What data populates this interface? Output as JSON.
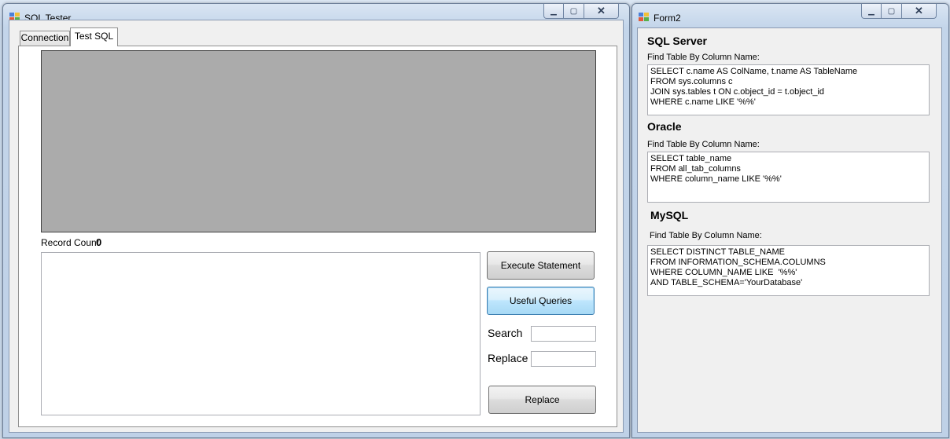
{
  "windows": {
    "sql_tester": {
      "title": "SQL Tester",
      "tabs": [
        {
          "label": "Connection",
          "active": false
        },
        {
          "label": "Test SQL",
          "active": true
        }
      ],
      "record_count_label": "Record Count",
      "record_count_value": "0",
      "query_text": "",
      "buttons": {
        "execute": "Execute Statement",
        "useful_queries": "Useful Queries",
        "replace": "Replace"
      },
      "search_label": "Search",
      "replace_label": "Replace",
      "search_value": "",
      "replace_value": ""
    },
    "form2": {
      "title": "Form2",
      "sections": [
        {
          "heading": "SQL Server",
          "caption": "Find Table By Column Name:",
          "query": "SELECT c.name AS ColName, t.name AS TableName\nFROM sys.columns c\nJOIN sys.tables t ON c.object_id = t.object_id\nWHERE c.name LIKE '%%'"
        },
        {
          "heading": "Oracle",
          "caption": "Find Table By Column Name:",
          "query": "SELECT table_name\nFROM all_tab_columns\nWHERE column_name LIKE '%%'"
        },
        {
          "heading": "MySQL",
          "caption": "Find Table By Column Name:",
          "query": "SELECT DISTINCT TABLE_NAME\nFROM INFORMATION_SCHEMA.COLUMNS\nWHERE COLUMN_NAME LIKE  '%%'\nAND TABLE_SCHEMA='YourDatabase'"
        }
      ]
    }
  },
  "icons": {
    "minimize": "minimize-icon",
    "maximize": "maximize-icon",
    "close": "close-icon",
    "app": "app-icon"
  },
  "colors": {
    "grid_background": "#ababab",
    "focused_button": "#a7d9f5",
    "window_frame": "#c3d5ea"
  }
}
